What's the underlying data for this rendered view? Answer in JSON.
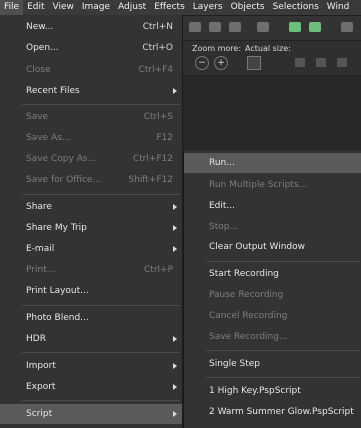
{
  "menubar": {
    "items": [
      "File",
      "Edit",
      "View",
      "Image",
      "Adjust",
      "Effects",
      "Layers",
      "Objects",
      "Selections",
      "Wind"
    ]
  },
  "toolbar": {
    "zoom_label": "Zoom more:",
    "actual_label": "Actual size:",
    "zoom_out": "−",
    "zoom_in": "+"
  },
  "file_menu": {
    "new": {
      "label": "New...",
      "shortcut": "Ctrl+N"
    },
    "open": {
      "label": "Open...",
      "shortcut": "Ctrl+O"
    },
    "close": {
      "label": "Close",
      "shortcut": "Ctrl+F4"
    },
    "recent": {
      "label": "Recent Files"
    },
    "save": {
      "label": "Save",
      "shortcut": "Ctrl+S"
    },
    "save_as": {
      "label": "Save As...",
      "shortcut": "F12"
    },
    "save_copy": {
      "label": "Save Copy As...",
      "shortcut": "Ctrl+F12"
    },
    "save_office": {
      "label": "Save for Office...",
      "shortcut": "Shift+F12"
    },
    "share": {
      "label": "Share"
    },
    "share_trip": {
      "label": "Share My Trip"
    },
    "email": {
      "label": "E-mail"
    },
    "print": {
      "label": "Print...",
      "shortcut": "Ctrl+P"
    },
    "print_layout": {
      "label": "Print Layout..."
    },
    "photo_blend": {
      "label": "Photo Blend..."
    },
    "hdr": {
      "label": "HDR"
    },
    "import": {
      "label": "Import"
    },
    "export": {
      "label": "Export"
    },
    "script": {
      "label": "Script"
    }
  },
  "script_menu": {
    "run": "Run...",
    "run_multiple": "Run Multiple Scripts...",
    "edit": "Edit...",
    "stop": "Stop...",
    "clear_output": "Clear Output Window",
    "start_recording": "Start Recording",
    "pause_recording": "Pause Recording",
    "cancel_recording": "Cancel Recording",
    "save_recording": "Save Recording...",
    "single_step": "Single Step",
    "recent1": "1 High Key.PspScript",
    "recent2": "2 Warm Summer Glow.PspScript"
  }
}
